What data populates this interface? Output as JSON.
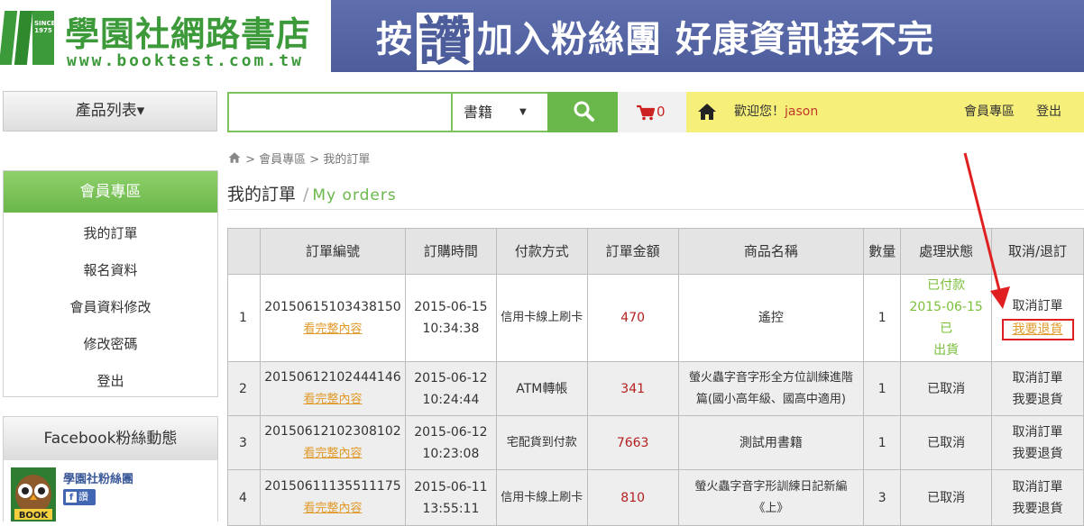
{
  "header": {
    "logo_title": "學園社網路書店",
    "logo_url": "www.booktest.com.tw",
    "logo_since": "SINCE 1975",
    "banner_pre": "按",
    "banner_big": "讚",
    "banner_post": "加入粉絲團 好康資訊接不完"
  },
  "topbar": {
    "product_list": "產品列表▾",
    "search_value": "",
    "search_placeholder": "",
    "category": "書籍",
    "caret": "▼",
    "cart_count": "0",
    "welcome_prefix": "歡迎您！",
    "username": "jason",
    "member_link": "會員專區",
    "logout": "登出"
  },
  "sidebar": {
    "member_title": "會員專區",
    "items": [
      {
        "label": "我的訂單"
      },
      {
        "label": "報名資料"
      },
      {
        "label": "會員資料修改"
      },
      {
        "label": "修改密碼"
      },
      {
        "label": "登出"
      }
    ],
    "fb_title": "Facebook粉絲動態",
    "fb_page_name": "學園社粉絲團",
    "fb_like": "讚",
    "fb_avatar_text": "BOOK"
  },
  "main": {
    "breadcrumb": "> 會員專區 > 我的訂單",
    "title": "我的訂單",
    "title_sep": "/",
    "subtitle": "My orders",
    "columns": [
      "訂單編號",
      "訂購時間",
      "付款方式",
      "訂單金額",
      "商品名稱",
      "數量",
      "處理狀態",
      "取消/退訂"
    ],
    "orders": [
      {
        "idx": "1",
        "order_no": "20150615103438150",
        "detail": "看完整內容",
        "date": "2015-06-15",
        "time": "10:34:38",
        "payment": "信用卡線上刷卡",
        "amount": "470",
        "product": "遙控",
        "qty": "1",
        "status_line1": "已付款",
        "status_line2": "2015-06-15 已",
        "status_line3": "出貨",
        "cancel": "取消訂單",
        "return": "我要退貨"
      },
      {
        "idx": "2",
        "order_no": "20150612102444146",
        "detail": "看完整內容",
        "date": "2015-06-12",
        "time": "10:24:44",
        "payment": "ATM轉帳",
        "amount": "341",
        "product_line1": "螢火蟲字音字形全方位訓練進階",
        "product_line2": "篇(國小高年級、國高中適用)",
        "qty": "1",
        "status": "已取消",
        "cancel": "取消訂單",
        "return": "我要退貨"
      },
      {
        "idx": "3",
        "order_no": "20150612102308102",
        "detail": "看完整內容",
        "date": "2015-06-12",
        "time": "10:23:08",
        "payment": "宅配貨到付款",
        "amount": "7663",
        "product": "測試用書籍",
        "qty": "1",
        "status": "已取消",
        "cancel": "取消訂單",
        "return": "我要退貨"
      },
      {
        "idx": "4",
        "order_no": "20150611135511175",
        "detail": "看完整內容",
        "date": "2015-06-11",
        "time": "13:55:11",
        "payment": "信用卡線上刷卡",
        "amount": "810",
        "product_line1": "螢火蟲字音字形訓練日記新編",
        "product_line2": "《上》",
        "qty": "3",
        "status": "已取消",
        "cancel": "取消訂單",
        "return": "我要退貨"
      }
    ]
  },
  "colors": {
    "brand_green": "#3d9a3a",
    "accent_green": "#6ab74b",
    "banner_blue": "#4d5d9c",
    "amount_red": "#b41f1f",
    "link_orange": "#e09a2b",
    "welcome_yellow": "#f6ef7a",
    "annotation_red": "#e02020"
  }
}
